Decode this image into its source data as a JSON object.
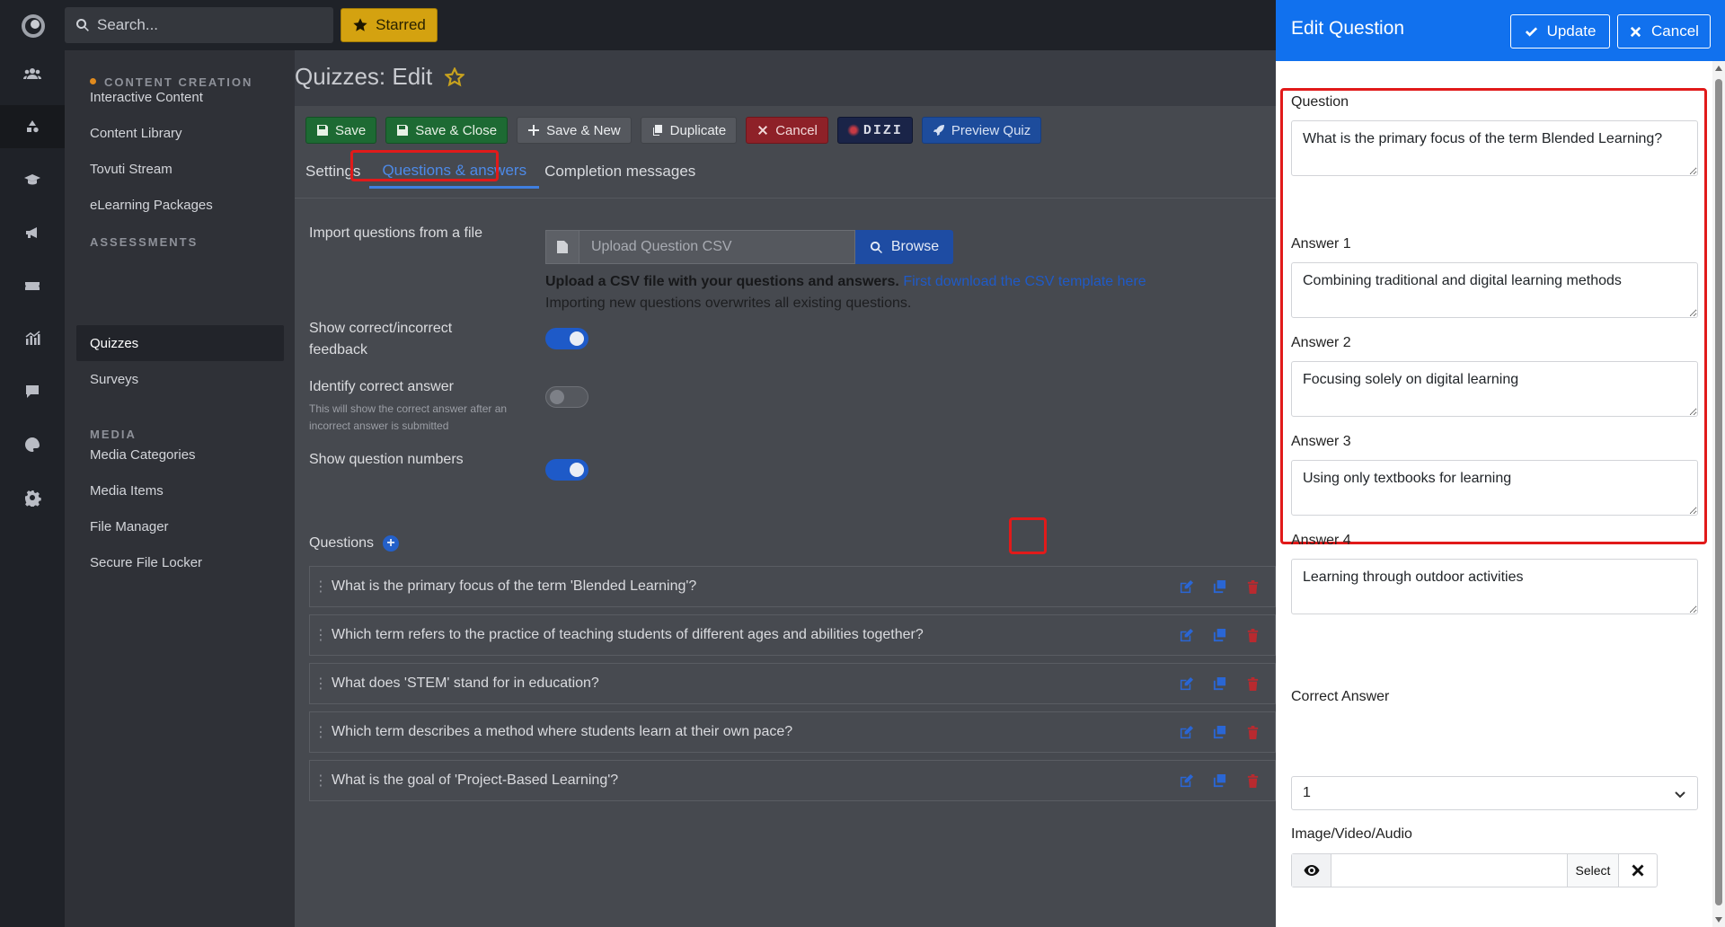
{
  "topbar": {
    "search_placeholder": "Search...",
    "starred_label": "Starred"
  },
  "sidenav": {
    "sections": [
      {
        "heading": "CONTENT CREATION",
        "items": [
          "Interactive Content",
          "Content Library",
          "Tovuti Stream",
          "eLearning Packages"
        ]
      },
      {
        "heading": "ASSESSMENTS",
        "items": [
          "Quizzes",
          "Surveys"
        ]
      },
      {
        "heading": "MEDIA",
        "items": [
          "Media Categories",
          "Media Items",
          "File Manager",
          "Secure File Locker"
        ]
      }
    ],
    "active_item": "Quizzes"
  },
  "main": {
    "page_title": "Quizzes: Edit",
    "toolbar": {
      "save": "Save",
      "save_close": "Save & Close",
      "save_new": "Save & New",
      "duplicate": "Duplicate",
      "cancel": "Cancel",
      "dizi": "DIZI",
      "preview": "Preview Quiz"
    },
    "tabs": [
      "Settings",
      "Questions & answers",
      "Completion messages"
    ],
    "active_tab": "Questions & answers",
    "import_label": "Import questions from a file",
    "upload_placeholder": "Upload Question CSV",
    "browse_label": "Browse",
    "csv_note_bold": "Upload a CSV file with your questions and answers.",
    "csv_note_link": "First download the CSV template here",
    "csv_note_sub": "Importing new questions overwrites all existing questions.",
    "settings": [
      {
        "label": "Show correct/incorrect feedback",
        "on": true
      },
      {
        "label": "Identify correct answer",
        "on": false,
        "help": "This will show the correct answer after an incorrect answer is submitted"
      },
      {
        "label": "Show question numbers",
        "on": true
      }
    ],
    "questions_label": "Questions",
    "questions": [
      "What is the primary focus of the term 'Blended Learning'?",
      "Which term refers to the practice of teaching students of different ages and abilities together?",
      "What does 'STEM' stand for in education?",
      "Which term describes a method where students learn at their own pace?",
      "What is the goal of 'Project-Based Learning'?"
    ]
  },
  "drawer": {
    "title": "Edit Question",
    "update_label": "Update",
    "cancel_label": "Cancel",
    "question_label": "Question",
    "question_value": "What is the primary focus of the term Blended Learning?",
    "answers": [
      {
        "label": "Answer 1",
        "value": "Combining traditional and digital learning methods"
      },
      {
        "label": "Answer 2",
        "value": "Focusing solely on digital learning"
      },
      {
        "label": "Answer 3",
        "value": "Using only textbooks for learning"
      },
      {
        "label": "Answer 4",
        "value": "Learning through outdoor activities"
      }
    ],
    "correct_answer_label": "Correct Answer",
    "correct_answer_value": "1",
    "media_label": "Image/Video/Audio",
    "select_label": "Select"
  },
  "colors": {
    "highlight": "#e11a1a",
    "drawer_header": "#1171ee",
    "accent_blue": "#1e5ac8",
    "starred": "#d4a210"
  }
}
